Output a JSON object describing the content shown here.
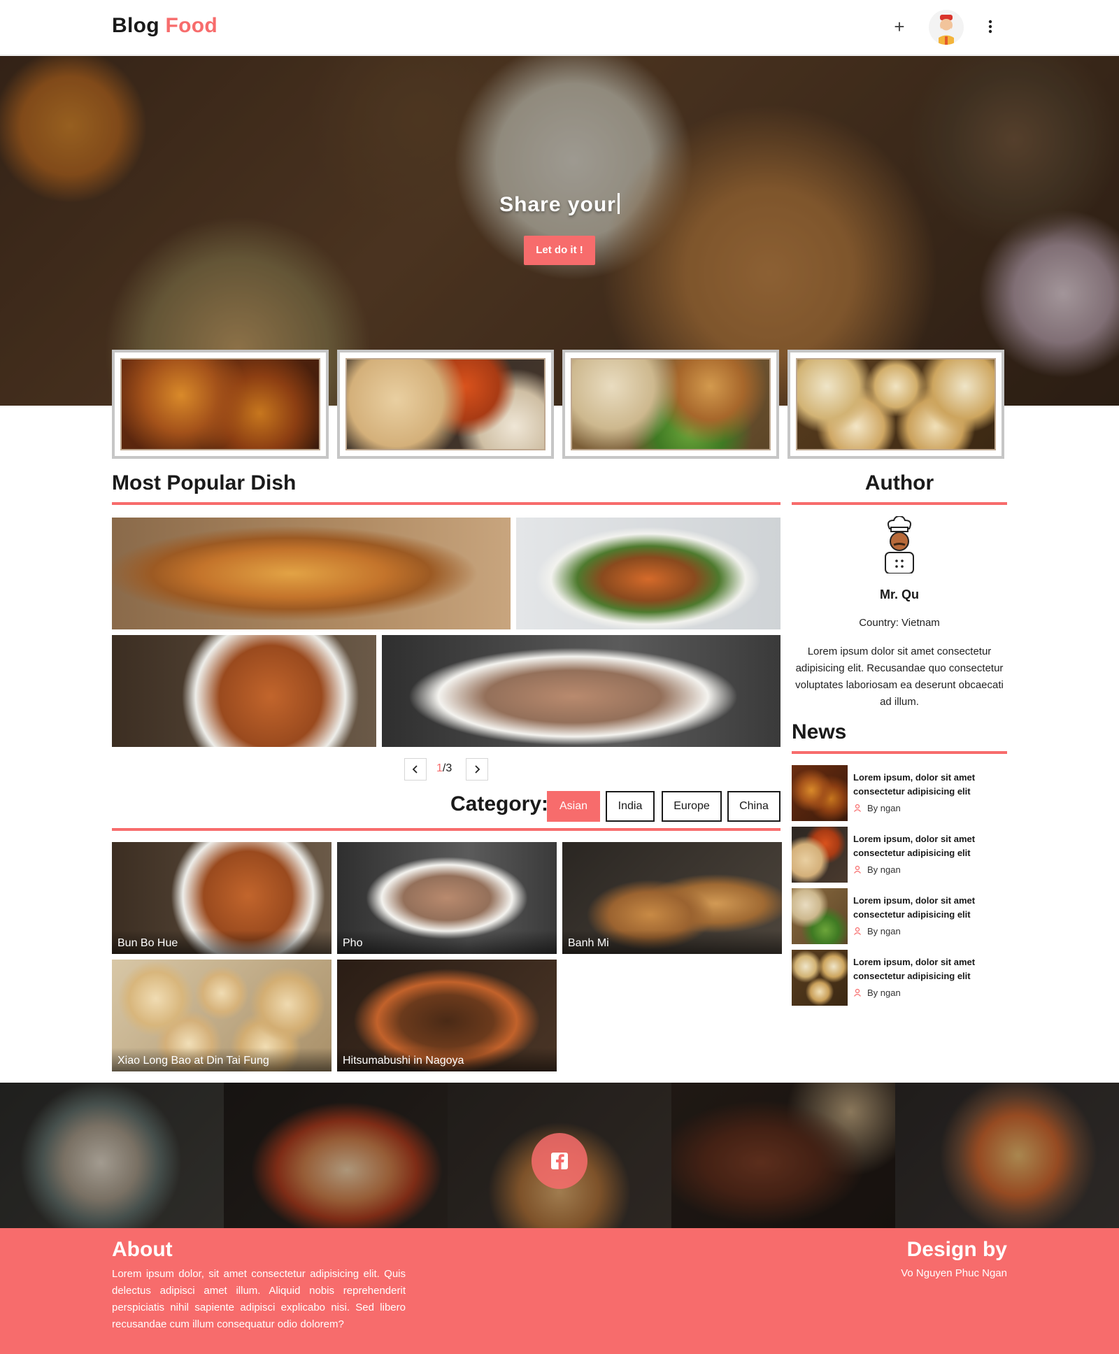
{
  "header": {
    "logo_part1": "Blog",
    "logo_part2": "Food",
    "add_icon": "plus-icon",
    "avatar_icon": "chef-avatar-icon",
    "menu_icon": "more-vertical-icon"
  },
  "hero": {
    "title": "Share your",
    "button_label": "Let do it !"
  },
  "popular": {
    "title": "Most Popular Dish",
    "page_current": "1",
    "page_total": "/3",
    "prev_icon": "chevron-left-icon",
    "next_icon": "chevron-right-icon"
  },
  "category": {
    "label": "Category:",
    "tabs": [
      "Asian",
      "India",
      "Europe",
      "China"
    ],
    "active_tab": "Asian",
    "dishes": [
      "Bun Bo Hue",
      "Pho",
      "Banh Mi",
      "Xiao Long Bao at Din Tai Fung",
      "Hitsumabushi in Nagoya"
    ]
  },
  "author": {
    "title": "Author",
    "name": "Mr. Qu",
    "country": "Country: Vietnam",
    "bio": "Lorem ipsum dolor sit amet consectetur adipisicing elit. Recusandae quo consectetur voluptates laboriosam ea deserunt obcaecati ad illum."
  },
  "news": {
    "title": "News",
    "items": [
      {
        "title": "Lorem ipsum, dolor sit amet consectetur adipisicing elit",
        "by": "By ngan"
      },
      {
        "title": "Lorem ipsum, dolor sit amet consectetur adipisicing elit",
        "by": "By ngan"
      },
      {
        "title": "Lorem ipsum, dolor sit amet consectetur adipisicing elit",
        "by": "By ngan"
      },
      {
        "title": "Lorem ipsum, dolor sit amet consectetur adipisicing elit",
        "by": "By ngan"
      }
    ]
  },
  "footer": {
    "about_title": "About",
    "about_text": "Lorem ipsum dolor, sit amet consectetur adipisicing elit. Quis delectus adipisci amet illum. Aliquid nobis reprehenderit perspiciatis nihil sapiente adipisci explicabo nisi. Sed libero recusandae cum illum consequatur odio dolorem?",
    "design_title": "Design by",
    "design_name": "Vo Nguyen Phuc Ngan",
    "social_icon": "facebook-icon"
  },
  "colors": {
    "accent": "#f76c6c",
    "text": "#1a1a1a"
  }
}
